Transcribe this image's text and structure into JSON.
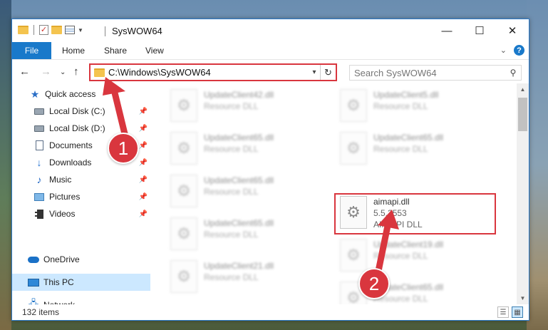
{
  "window": {
    "title": "SysWOW64",
    "controls": {
      "minimize": "—",
      "maximize": "☐",
      "close": "✕"
    }
  },
  "ribbon": {
    "tabs": [
      "File",
      "Home",
      "Share",
      "View"
    ],
    "help": "?",
    "expand": "⌄"
  },
  "nav": {
    "back": "←",
    "forward": "→",
    "recent": "⌄",
    "up": "↑",
    "address": "C:\\Windows\\SysWOW64",
    "search_placeholder": "Search SysWOW64"
  },
  "sidebar": {
    "items": [
      {
        "label": "Quick access",
        "icon": "star-icon",
        "pinned": false
      },
      {
        "label": "Local Disk (C:)",
        "icon": "drive-icon",
        "pinned": true
      },
      {
        "label": "Local Disk (D:)",
        "icon": "drive-icon",
        "pinned": true
      },
      {
        "label": "Documents",
        "icon": "documents-icon",
        "pinned": true
      },
      {
        "label": "Downloads",
        "icon": "downloads-icon",
        "pinned": true
      },
      {
        "label": "Music",
        "icon": "music-icon",
        "pinned": true
      },
      {
        "label": "Pictures",
        "icon": "pictures-icon",
        "pinned": true
      },
      {
        "label": "Videos",
        "icon": "videos-icon",
        "pinned": true
      },
      {
        "label": "OneDrive",
        "icon": "onedrive-icon",
        "pinned": false
      },
      {
        "label": "This PC",
        "icon": "this-pc-icon",
        "pinned": false,
        "selected": true
      },
      {
        "label": "Network",
        "icon": "network-icon",
        "pinned": false
      }
    ]
  },
  "files": [
    {
      "name": "UpdateClient42.dll",
      "line2": "Resource DLL",
      "line3": "",
      "blurred": true
    },
    {
      "name": "UpdateClient5.dll",
      "line2": "Resource DLL",
      "line3": "",
      "blurred": true
    },
    {
      "name": "UpdateClient65.dll",
      "line2": "Resource DLL",
      "line3": "",
      "blurred": true
    },
    {
      "name": "UpdateClient65.dll",
      "line2": "Resource DLL",
      "line3": "",
      "blurred": true
    },
    {
      "name": "UpdateClient65.dll",
      "line2": "Resource DLL",
      "line3": "",
      "blurred": true
    },
    {
      "name": "aimapi.dll",
      "line2": "5.5.3553",
      "line3": "AIM API DLL",
      "blurred": false
    },
    {
      "name": "UpdateClient65.dll",
      "line2": "Resource DLL",
      "line3": "",
      "blurred": true
    },
    {
      "name": "UpdateClient19.dll",
      "line2": "Resource DLL",
      "line3": "",
      "blurred": true
    },
    {
      "name": "UpdateClient21.dll",
      "line2": "Resource DLL",
      "line3": "",
      "blurred": true
    },
    {
      "name": "UpdateClient65.dll",
      "line2": "Resource DLL",
      "line3": "",
      "blurred": true
    }
  ],
  "status": {
    "item_count": "132 items"
  },
  "annotations": {
    "step1": "1",
    "step2": "2",
    "color": "#d9363e"
  }
}
